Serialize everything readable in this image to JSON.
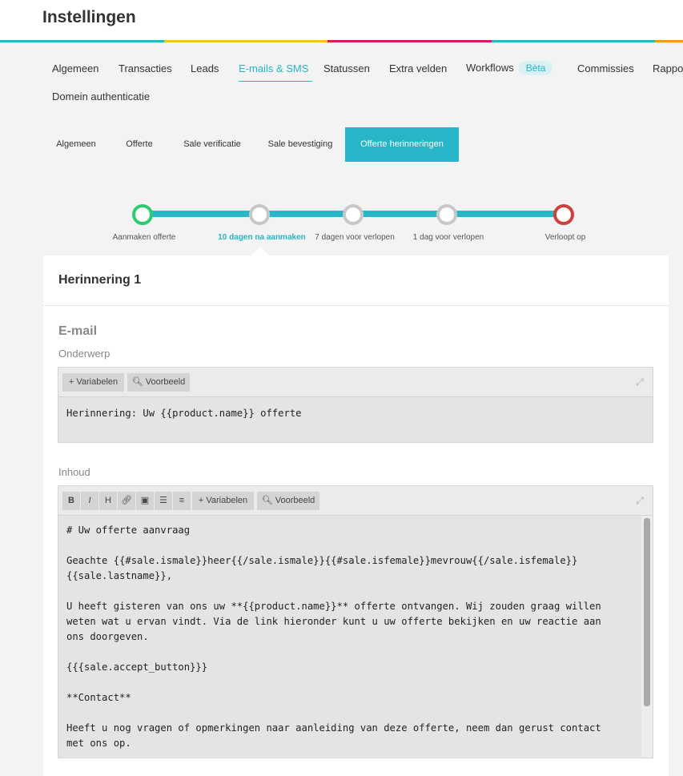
{
  "header": {
    "title": "Instellingen",
    "bar_colors": [
      "#27b6c7",
      "#f0c419",
      "#d81b60",
      "#27b6c7",
      "#f39c12"
    ]
  },
  "main_tabs": {
    "items": [
      {
        "label": "Algemeen"
      },
      {
        "label": "Transacties"
      },
      {
        "label": "Leads"
      },
      {
        "label": "E-mails & SMS",
        "active": true
      },
      {
        "label": "Statussen"
      },
      {
        "label": "Extra velden"
      },
      {
        "label": "Workflows",
        "badge": "Bèta"
      },
      {
        "label": "Commissies"
      },
      {
        "label": "Rappor"
      },
      {
        "label": "Domein authenticatie"
      }
    ]
  },
  "sub_tabs": {
    "items": [
      {
        "label": "Algemeen"
      },
      {
        "label": "Offerte"
      },
      {
        "label": "Sale verificatie"
      },
      {
        "label": "Sale bevestiging"
      },
      {
        "label": "Offerte herinneringen",
        "active": true
      }
    ]
  },
  "timeline": {
    "steps": [
      {
        "label": "Aanmaken offerte",
        "color": "#2ecc71"
      },
      {
        "label": "10 dagen na aanmaken",
        "color": "#c8c8c8",
        "active": true
      },
      {
        "label": "7 dagen voor verlopen",
        "color": "#c8c8c8"
      },
      {
        "label": "1 dag voor verlopen",
        "color": "#c8c8c8"
      },
      {
        "label": "Verloopt op",
        "color": "#d0413a"
      }
    ],
    "line_color": "#29b6c7"
  },
  "card": {
    "title": "Herinnering 1",
    "section_title": "E-mail",
    "subject": {
      "label": "Onderwerp",
      "toolbar": {
        "variables": "+ Variabelen",
        "preview": "Voorbeeld"
      },
      "value": "Herinnering: Uw {{product.name}} offerte"
    },
    "body": {
      "label": "Inhoud",
      "toolbar": {
        "bold": "B",
        "italic": "I",
        "heading": "H",
        "variables": "+ Variabelen",
        "preview": "Voorbeeld"
      },
      "value": "# Uw offerte aanvraag\n\nGeachte {{#sale.ismale}}heer{{/sale.ismale}}{{#sale.isfemale}}mevrouw{{/sale.isfemale}}\n{{sale.lastname}},\n\nU heeft gisteren van ons uw **{{product.name}}** offerte ontvangen. Wij zouden graag willen\nweten wat u ervan vindt. Via de link hieronder kunt u uw offerte bekijken en uw reactie aan\nons doorgeven.\n\n{{{sale.accept_button}}}\n\n**Contact**\n\nHeeft u nog vragen of opmerkingen naar aanleiding van deze offerte, neem dan gerust contact\nmet ons op."
    }
  }
}
